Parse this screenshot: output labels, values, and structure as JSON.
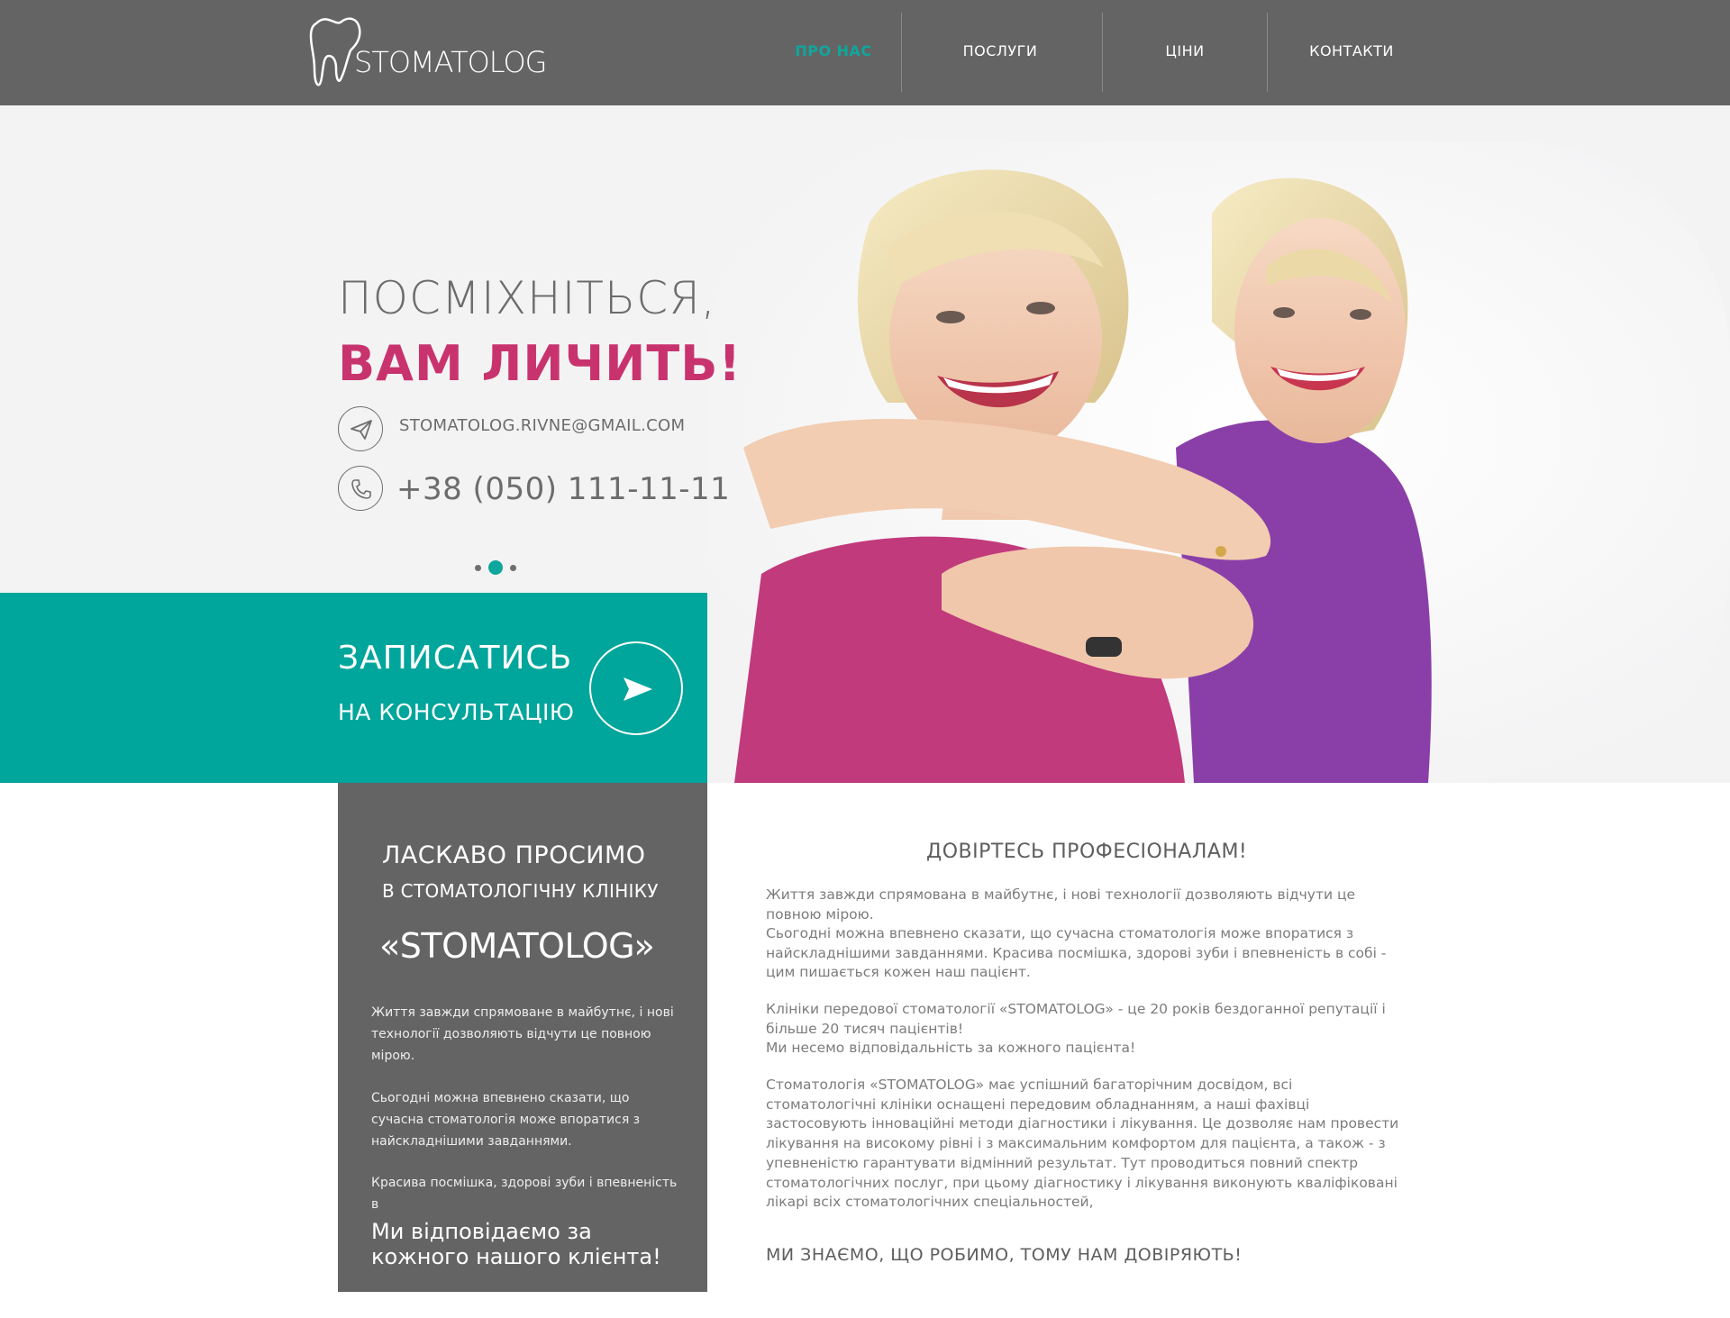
{
  "brand": {
    "logo_text": "STOMATOLOG",
    "accent": "#0fa79d",
    "pink": "#c8336e",
    "header_bg": "#646464"
  },
  "nav": {
    "items": [
      {
        "label": "ПРО НАС",
        "active": true
      },
      {
        "label": "ПОСЛУГИ",
        "active": false
      },
      {
        "label": "ЦІНИ",
        "active": false
      },
      {
        "label": "КОНТАКТИ",
        "active": false
      }
    ]
  },
  "hero": {
    "title_line1": "ПОСМІХНІТЬСЯ,",
    "title_line2": "ВАМ ЛИЧИТЬ!",
    "email": "STOMATOLOG.RIVNE@GMAIL.COM",
    "phone": "+38 (050) 111-11-11",
    "slider": {
      "count": 3,
      "active_index": 1
    },
    "cta_line1": "ЗАПИСАТИСЬ",
    "cta_line2": "НА КОНСУЛЬТАЦІЮ"
  },
  "welcome": {
    "title": "ЛАСКАВО ПРОСИМО",
    "subtitle": "В СТОМАТОЛОГІЧНУ КЛІНІКУ",
    "name": "«STOMATOLOG»",
    "p1": "Життя завжди спрямоване в майбутнє, і нові технології дозволяють відчути це повною мірою.",
    "p2": "Сьогодні можна впевнено сказати, що сучасна стоматологія може впоратися з найскладнішими завданнями.",
    "p3": "Красива посмішка, здорові зуби і впевненість в",
    "strong": "Ми відповідаємо за кожного нашого клієнта!"
  },
  "about": {
    "title": "ДОВІРТЕСЬ ПРОФЕСІОНАЛАМ!",
    "p1a": "Життя завжди спрямована в майбутнє, і нові технології дозволяють відчути це повною мірою.",
    "p1b": "Сьогодні можна впевнено сказати, що сучасна стоматологія може впоратися з найскладнішими завданнями. Красива посмішка, здорові зуби і впевненість в собі - цим пишається кожен наш пацієнт.",
    "p2a": "Клініки передової стоматології «STOMATOLOG» - це 20 років бездоганної репутації і більше 20 тисяч пацієнтів!",
    "p2b": "Ми несемо відповідальність за кожного пацієнта!",
    "p3": "Стоматологія «STOMATOLOG»  має успішний багаторічним досвідом, всі стоматологічні клініки оснащені передовим обладнанням, а наші фахівці застосовують інноваційні методи діагностики і лікування. Це дозволяє нам провести лікування на високому рівні і з максимальним комфортом для пацієнта, а також - з упевненістю гарантувати відмінний результат.  Тут проводиться повний спектр стоматологічних послуг, при цьому діагностику і лікування виконують кваліфіковані лікарі всіх стоматологічних спеціальностей,",
    "footer": "МИ ЗНАЄМО, ЩО РОБИМО, ТОМУ НАМ ДОВІРЯЮТЬ!"
  }
}
